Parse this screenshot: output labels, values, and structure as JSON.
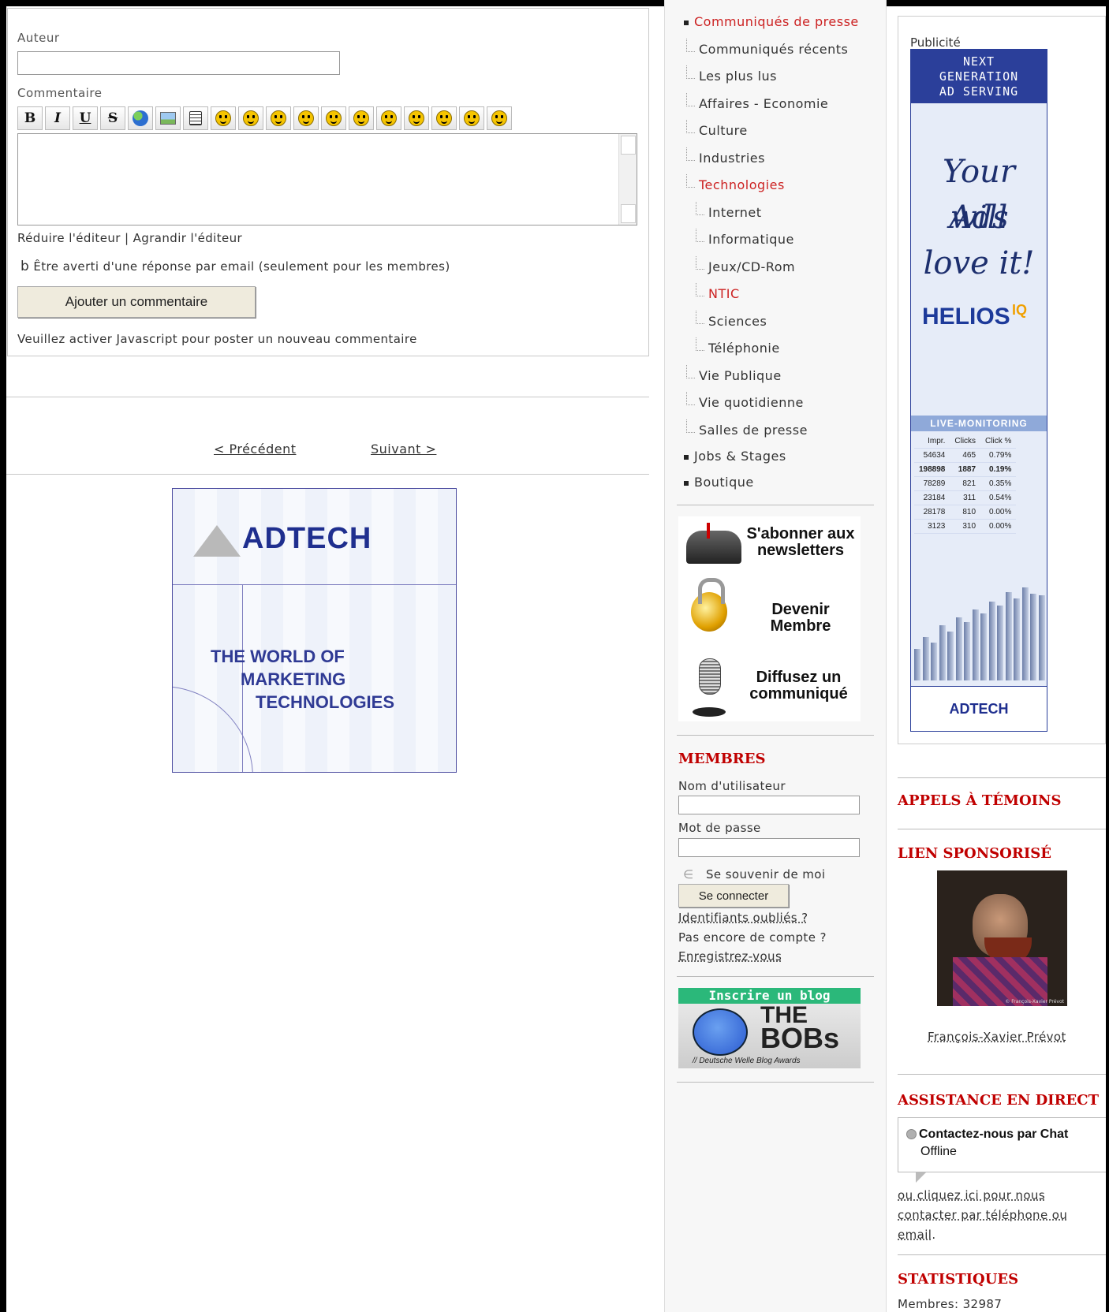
{
  "comment_form": {
    "author_label": "Auteur",
    "author_value": "",
    "comment_label": "Commentaire",
    "toolbar": {
      "bold": "B",
      "italic": "I",
      "underline": "U",
      "strike": "S"
    },
    "resize_small": "Réduire l'éditeur",
    "resize_sep": "|",
    "resize_large": "Agrandir l'éditeur",
    "notify_icon": "b",
    "notify_label": "Être averti d'une réponse par email (seulement pour les membres)",
    "submit_label": "Ajouter un commentaire",
    "js_notice": "Veuillez activer Javascript pour poster un nouveau commentaire"
  },
  "pagination": {
    "prev": "< Précédent",
    "next": "Suivant >"
  },
  "ad_adtech": {
    "logo": "ADTECH",
    "line1": "THE WORLD OF",
    "line2": "MARKETING",
    "line3": "TECHNOLOGIES"
  },
  "menu": {
    "items": [
      {
        "label": "Communiqués de presse",
        "level": 0,
        "active": true
      },
      {
        "label": "Communiqués récents",
        "level": 1
      },
      {
        "label": "Les plus lus",
        "level": 1
      },
      {
        "label": "Affaires - Economie",
        "level": 1
      },
      {
        "label": "Culture",
        "level": 1
      },
      {
        "label": "Industries",
        "level": 1
      },
      {
        "label": "Technologies",
        "level": 1,
        "active": true
      },
      {
        "label": "Internet",
        "level": 2
      },
      {
        "label": "Informatique",
        "level": 2
      },
      {
        "label": "Jeux/CD-Rom",
        "level": 2
      },
      {
        "label": "NTIC",
        "level": 2,
        "active": true
      },
      {
        "label": "Sciences",
        "level": 2
      },
      {
        "label": "Téléphonie",
        "level": 2
      },
      {
        "label": "Vie Publique",
        "level": 1
      },
      {
        "label": "Vie quotidienne",
        "level": 1
      },
      {
        "label": "Salles de presse",
        "level": 1
      },
      {
        "label": "Jobs & Stages",
        "level": 0
      },
      {
        "label": "Boutique",
        "level": 0
      }
    ]
  },
  "promo": {
    "newsletter": "S'abonner aux newsletters",
    "member": "Devenir Membre",
    "release": "Diffusez un communiqué"
  },
  "login": {
    "title": "MEMBRES",
    "username_label": "Nom d'utilisateur",
    "password_label": "Mot de passe",
    "remember_icon": "∈",
    "remember_label": "Se souvenir de moi",
    "submit_label": "Se connecter",
    "forgot_link": "Identifiants oubliés ?",
    "no_account": "Pas encore de compte ?",
    "register_link": "Enregistrez-vous"
  },
  "blog_banner": {
    "header": "Inscrire un blog",
    "the": "THE",
    "bobs": "BOBs",
    "sub": "// Deutsche Welle Blog Awards"
  },
  "pub": {
    "label": "Publicité",
    "top": [
      "NEXT",
      "GENERATION",
      "AD SERVING"
    ],
    "script": [
      "Your Ads",
      "will",
      "love it!"
    ],
    "brand": "HELIOS",
    "brand_sup": "IQ",
    "live": "LIVE-MONITORING",
    "table_head": [
      "Impr.",
      "Clicks",
      "Click %"
    ],
    "table_rows": [
      [
        "54634",
        "465",
        "0.79%"
      ],
      [
        "198898",
        "1887",
        "0.19%"
      ],
      [
        "78289",
        "821",
        "0.35%"
      ],
      [
        "23184",
        "311",
        "0.54%"
      ],
      [
        "28178",
        "810",
        "0.00%"
      ],
      [
        "3123",
        "310",
        "0.00%"
      ]
    ],
    "footer": "ADTECH"
  },
  "sidebar_right": {
    "appels": "APPELS À TÉMOINS",
    "sponsor": "LIEN SPONSORISÉ",
    "photo_caption": "© François-Xavier Prévot",
    "photo_author": "François-Xavier Prévot",
    "assistance": "ASSISTANCE EN DIRECT",
    "chat_title": "Contactez-nous par Chat",
    "chat_status": "Offline",
    "contact_link": "ou cliquez ici pour nous contacter par téléphone ou email",
    "contact_end": ".",
    "stats_title": "STATISTIQUES",
    "members_count": "Membres: 32987"
  },
  "colors": {
    "accent_red": "#c00000",
    "menu_red": "#cc2222",
    "adtech_blue": "#1f2f8f"
  }
}
